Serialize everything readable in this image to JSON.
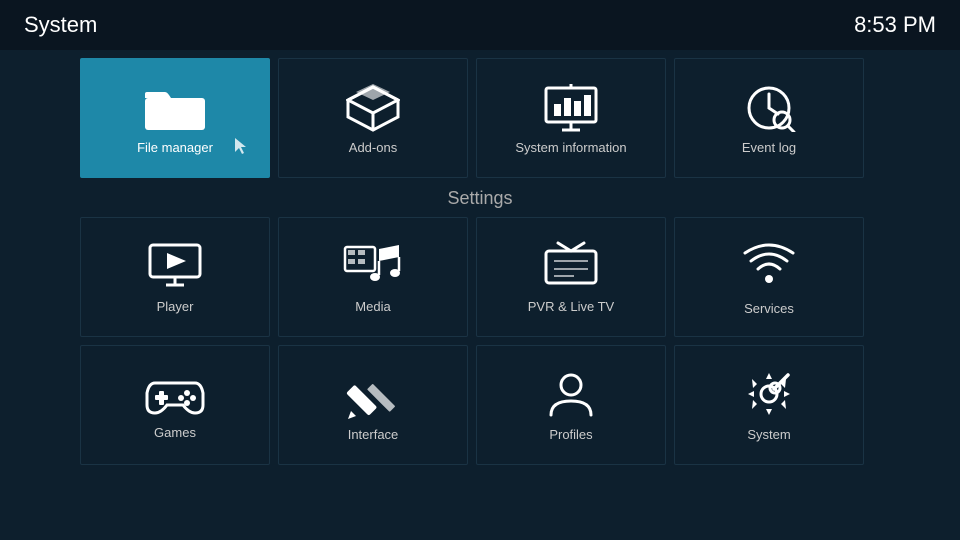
{
  "header": {
    "title": "System",
    "time": "8:53 PM"
  },
  "top_tiles": [
    {
      "id": "file-manager",
      "label": "File manager",
      "active": true
    },
    {
      "id": "add-ons",
      "label": "Add-ons",
      "active": false
    },
    {
      "id": "system-information",
      "label": "System information",
      "active": false
    },
    {
      "id": "event-log",
      "label": "Event log",
      "active": false
    }
  ],
  "settings_label": "Settings",
  "settings_row1": [
    {
      "id": "player",
      "label": "Player"
    },
    {
      "id": "media",
      "label": "Media"
    },
    {
      "id": "pvr-live-tv",
      "label": "PVR & Live TV"
    },
    {
      "id": "services",
      "label": "Services"
    }
  ],
  "settings_row2": [
    {
      "id": "games",
      "label": "Games"
    },
    {
      "id": "interface",
      "label": "Interface"
    },
    {
      "id": "profiles",
      "label": "Profiles"
    },
    {
      "id": "system",
      "label": "System"
    }
  ]
}
